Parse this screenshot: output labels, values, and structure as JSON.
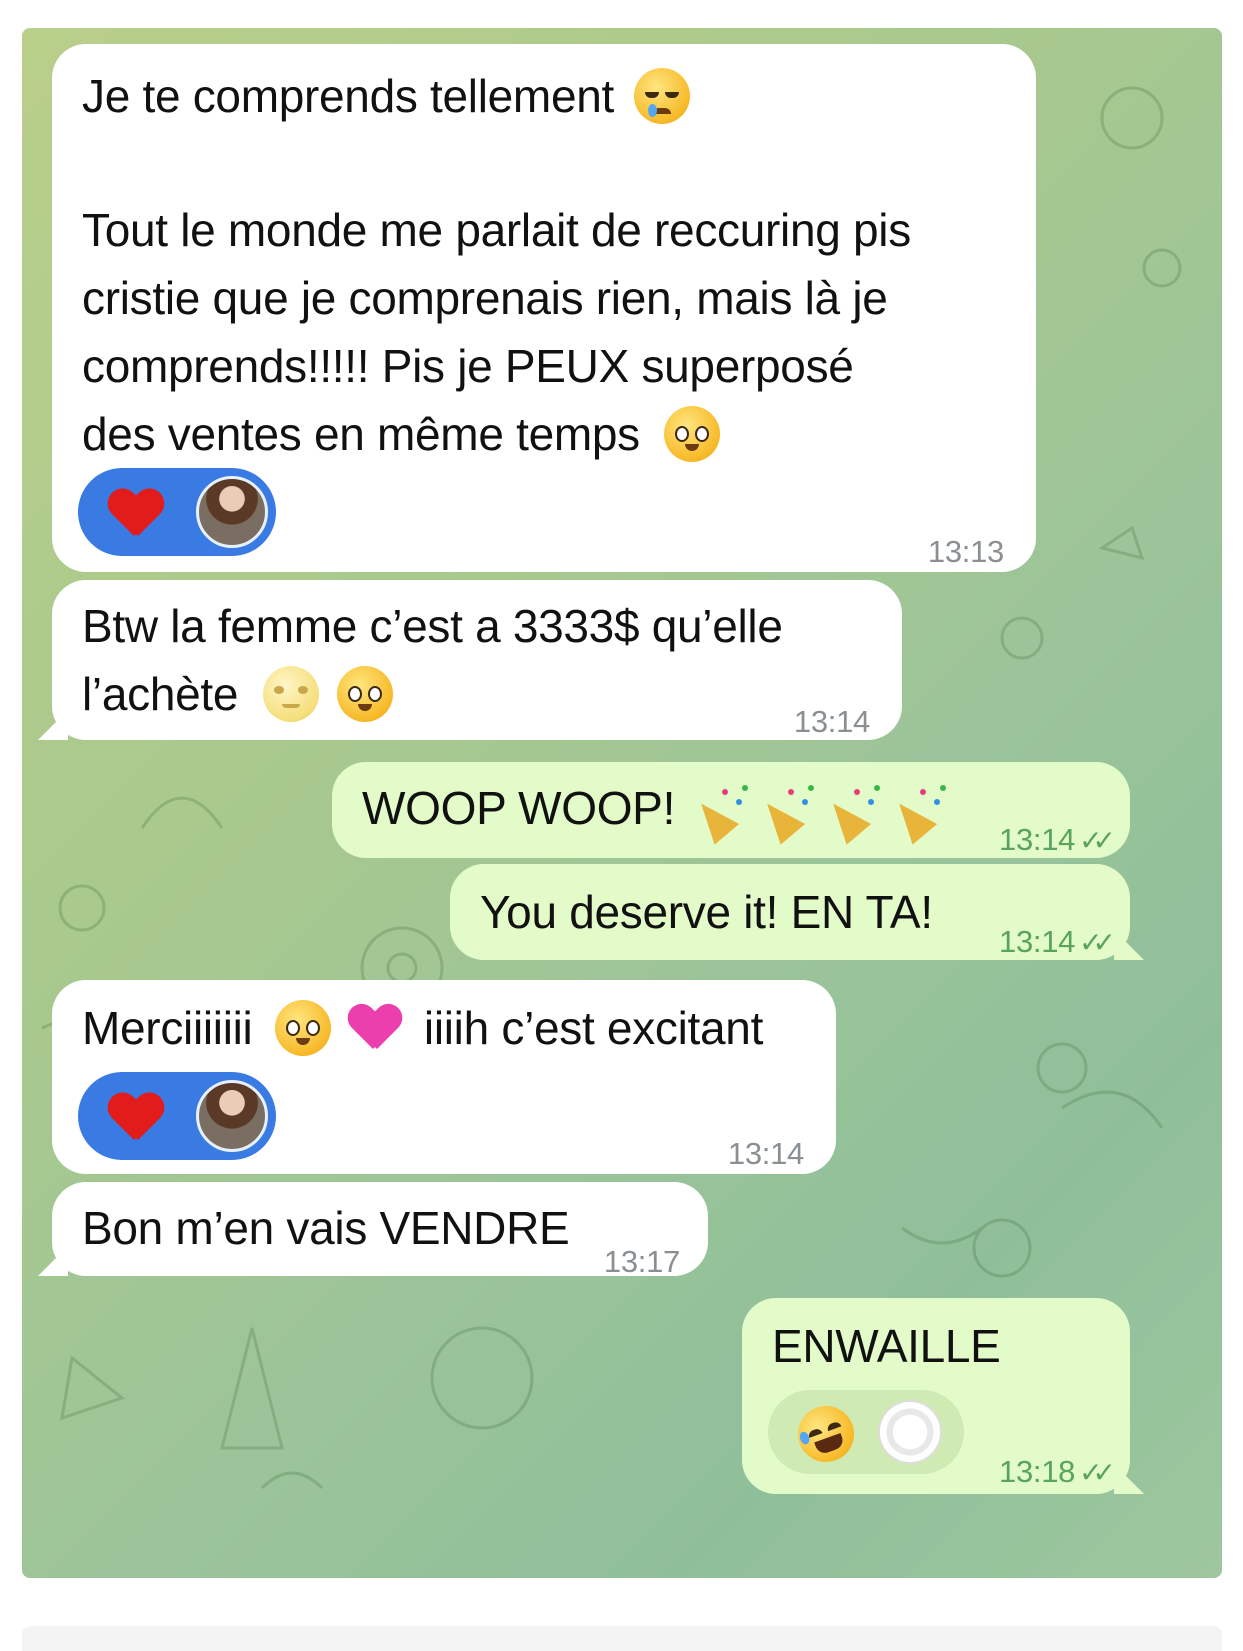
{
  "messages": [
    {
      "direction": "incoming",
      "lines": [
        "Je te comprends tellement",
        "",
        "Tout le monde me parlait de reccuring pis",
        "cristie que je comprenais rien, mais là je",
        "comprends!!!!! Pis je PEUX superposé",
        "des ventes en même temps"
      ],
      "emojis": [
        "crying-face",
        "pleading-face"
      ],
      "reactions": [
        "red-heart",
        "avatar"
      ],
      "time": "13:13"
    },
    {
      "direction": "incoming",
      "lines": [
        "Btw la femme c’est a 3333$ qu’elle",
        "l’achète"
      ],
      "emojis": [
        "moon-face",
        "pleading-face"
      ],
      "time": "13:14"
    },
    {
      "direction": "outgoing",
      "text": "WOOP WOOP!",
      "emojis": [
        "party-popper",
        "party-popper",
        "party-popper",
        "party-popper"
      ],
      "time": "13:14",
      "read": true
    },
    {
      "direction": "outgoing",
      "text": "You deserve it! EN TA!",
      "time": "13:14",
      "read": true
    },
    {
      "direction": "incoming",
      "text_before": "Merciiiiiii",
      "text_after": "iiiih c’est excitant",
      "emojis": [
        "pleading-face",
        "pink-heart"
      ],
      "reactions": [
        "red-heart",
        "avatar"
      ],
      "time": "13:14"
    },
    {
      "direction": "incoming",
      "text": "Bon m’en vais VENDRE",
      "time": "13:17"
    },
    {
      "direction": "outgoing",
      "text": "ENWAILLE",
      "reactions": [
        "rolling-on-floor-laughing",
        "avatar"
      ],
      "time": "13:18",
      "read": true
    }
  ],
  "colors": {
    "incoming_bubble": "#ffffff",
    "outgoing_bubble": "#e3fbc9",
    "reaction_pill": "#3a7ae3",
    "read_check": "#5aa35a"
  },
  "checkmark": "✓✓"
}
